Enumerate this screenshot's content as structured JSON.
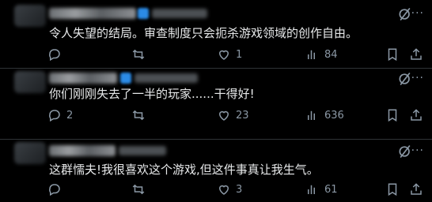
{
  "posts": [
    {
      "text": "令人失望的结局。审查制度只会扼杀游戏领域的创作自由。",
      "replies": "",
      "retweets": "",
      "likes": "1",
      "views": "84"
    },
    {
      "text": "你们刚刚失去了一半的玩家......干得好!",
      "replies": "2",
      "retweets": "",
      "likes": "23",
      "views": "636"
    },
    {
      "text": "这群懦夫!我很喜欢这个游戏,但这件事真让我生气。",
      "replies": "",
      "retweets": "",
      "likes": "3",
      "views": "61"
    }
  ],
  "icons": {
    "reply": "reply-icon",
    "retweet": "retweet-icon",
    "like": "heart-icon",
    "views": "views-icon",
    "bookmark": "bookmark-icon",
    "share": "share-icon",
    "grok": "grok-icon",
    "more": "more-icon"
  },
  "colors": {
    "background": "#000000",
    "text": "#e7e9ea",
    "muted": "#8b98a5",
    "verified": "#2b8be6"
  }
}
